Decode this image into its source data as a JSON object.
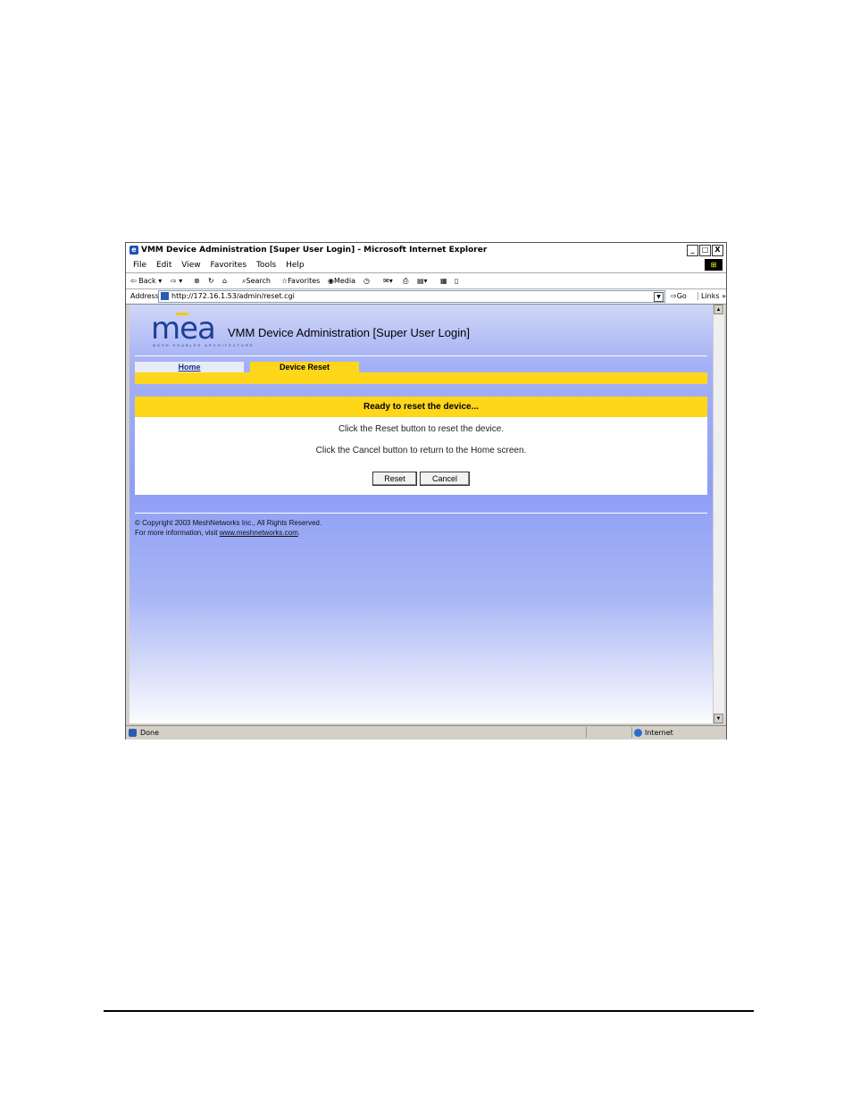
{
  "window": {
    "title": "VMM Device Administration [Super User Login] - Microsoft Internet Explorer",
    "buttons": {
      "minimize": "_",
      "maximize": "□",
      "close": "X"
    }
  },
  "menu": [
    "File",
    "Edit",
    "View",
    "Favorites",
    "Tools",
    "Help"
  ],
  "toolbar": {
    "back": "Back",
    "search": "Search",
    "favorites": "Favorites",
    "media": "Media"
  },
  "address": {
    "label": "Address",
    "url": "http://172.16.1.53/admin/reset.cgi",
    "go": "Go",
    "links": "Links"
  },
  "page": {
    "logo": {
      "mark": "mea",
      "tagline": "MESH ENABLED ARCHITECTURE"
    },
    "title": "VMM Device Administration [Super User Login]",
    "tabs": {
      "home": "Home",
      "active": "Device Reset"
    },
    "panel": {
      "heading": "Ready to reset the device...",
      "line1": "Click the Reset button to reset the device.",
      "line2": "Click the Cancel button to return to the Home screen.",
      "reset_label": "Reset",
      "cancel_label": "Cancel"
    },
    "footer": {
      "copyright": "© Copyright 2003 MeshNetworks Inc., All Rights Reserved.",
      "more_prefix": "For more information, visit ",
      "link": "www.meshnetworks.com",
      "suffix": "."
    }
  },
  "status": {
    "text": "Done",
    "zone": "Internet"
  },
  "colors": {
    "accent": "#ffd71a",
    "brand": "#1d3f99"
  }
}
